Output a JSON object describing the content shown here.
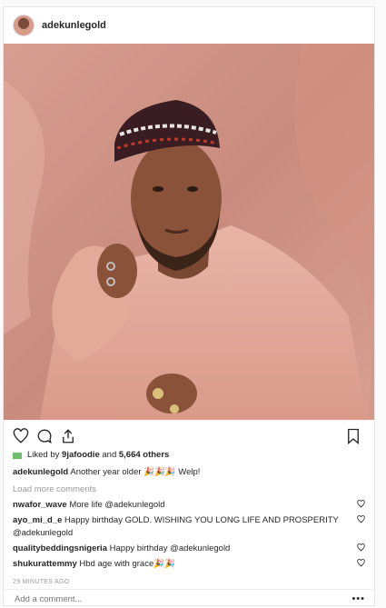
{
  "post": {
    "username": "adekunlegold"
  },
  "likes": {
    "prefix": "Liked by",
    "user": "9jafoodie",
    "middle": "and",
    "count": "5,664 others"
  },
  "caption": {
    "user": "adekunlegold",
    "text": "Another year older 🎉🎉🎉 Welp!"
  },
  "load_more": "Load more comments",
  "comments": [
    {
      "user": "nwafor_wave",
      "text": "More life @adekunlegold"
    },
    {
      "user": "ayo_mi_d_e",
      "text": "Happy birthday GOLD. WISHING YOU LONG LIFE AND PROSPERITY @adekunlegold"
    },
    {
      "user": "qualitybeddingsnigeria",
      "text": "Happy birthday @adekunlegold"
    },
    {
      "user": "shukurattemmy",
      "text": "Hbd age with grace🎉🎉"
    }
  ],
  "timestamp": "29 MINUTES AGO",
  "add_comment": {
    "placeholder": "Add a comment..."
  },
  "more_label": "•••",
  "icons": [
    "heart-icon",
    "comment-icon",
    "share-icon",
    "bookmark-icon",
    "more-options-icon"
  ]
}
